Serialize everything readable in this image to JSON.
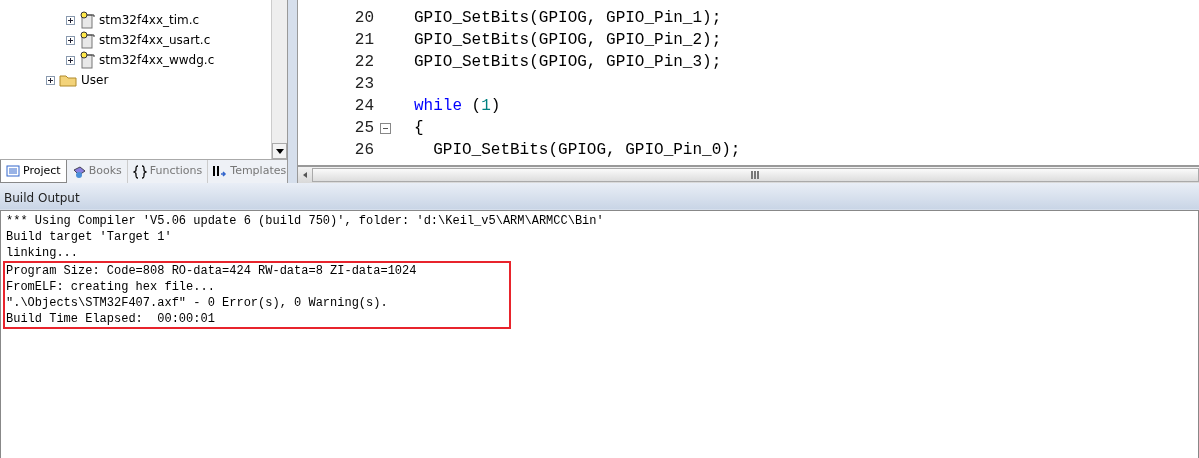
{
  "project_tree": {
    "items": [
      {
        "label": "stm32f4xx_tim.c",
        "kind": "file",
        "expanded": false
      },
      {
        "label": "stm32f4xx_usart.c",
        "kind": "file",
        "expanded": false
      },
      {
        "label": "stm32f4xx_wwdg.c",
        "kind": "file",
        "expanded": false
      },
      {
        "label": "User",
        "kind": "folder",
        "expanded": false
      }
    ]
  },
  "panel_tabs": [
    {
      "label": "Project",
      "kind": "project",
      "selected": true
    },
    {
      "label": "Books",
      "kind": "books",
      "selected": false
    },
    {
      "label": "Functions",
      "kind": "functions",
      "selected": false
    },
    {
      "label": "Templates",
      "kind": "templates",
      "selected": false
    }
  ],
  "editor": {
    "lines": [
      {
        "number": "20",
        "fold": false,
        "segments": [
          {
            "text": "GPIO_SetBits(GPIOG, GPIO_Pin_1);",
            "kind": "plain"
          }
        ]
      },
      {
        "number": "21",
        "fold": false,
        "segments": [
          {
            "text": "GPIO_SetBits(GPIOG, GPIO_Pin_2);",
            "kind": "plain"
          }
        ]
      },
      {
        "number": "22",
        "fold": false,
        "segments": [
          {
            "text": "GPIO_SetBits(GPIOG, GPIO_Pin_3);",
            "kind": "plain"
          }
        ]
      },
      {
        "number": "23",
        "fold": false
      },
      {
        "number": "24",
        "fold": false,
        "segments": [
          {
            "text": "while",
            "kind": "keyword"
          },
          {
            "text": " (",
            "kind": "plain"
          },
          {
            "text": "1",
            "kind": "number"
          },
          {
            "text": ")",
            "kind": "plain"
          }
        ]
      },
      {
        "number": "25",
        "fold": true,
        "segments": [
          {
            "text": "{",
            "kind": "plain"
          }
        ]
      },
      {
        "number": "26",
        "fold": false,
        "segments": [
          {
            "text": "  GPIO_SetBits(GPIOG, GPIO_Pin_0);",
            "kind": "plain"
          }
        ]
      }
    ]
  },
  "build_output": {
    "title": "Build Output",
    "lines": [
      {
        "text": "*** Using Compiler 'V5.06 update 6 (build 750)', folder: 'd:\\Keil_v5\\ARM\\ARMCC\\Bin'",
        "highlighted": false
      },
      {
        "text": "Build target 'Target 1'",
        "highlighted": false
      },
      {
        "text": "linking...",
        "highlighted": false
      },
      {
        "text": "Program Size: Code=808 RO-data=424 RW-data=8 ZI-data=1024",
        "highlighted": true
      },
      {
        "text": "FromELF: creating hex file...",
        "highlighted": true
      },
      {
        "text": "\".\\Objects\\STM32F407.axf\" - 0 Error(s), 0 Warning(s).",
        "highlighted": true
      },
      {
        "text": "Build Time Elapsed:  00:00:01",
        "highlighted": true
      }
    ]
  }
}
